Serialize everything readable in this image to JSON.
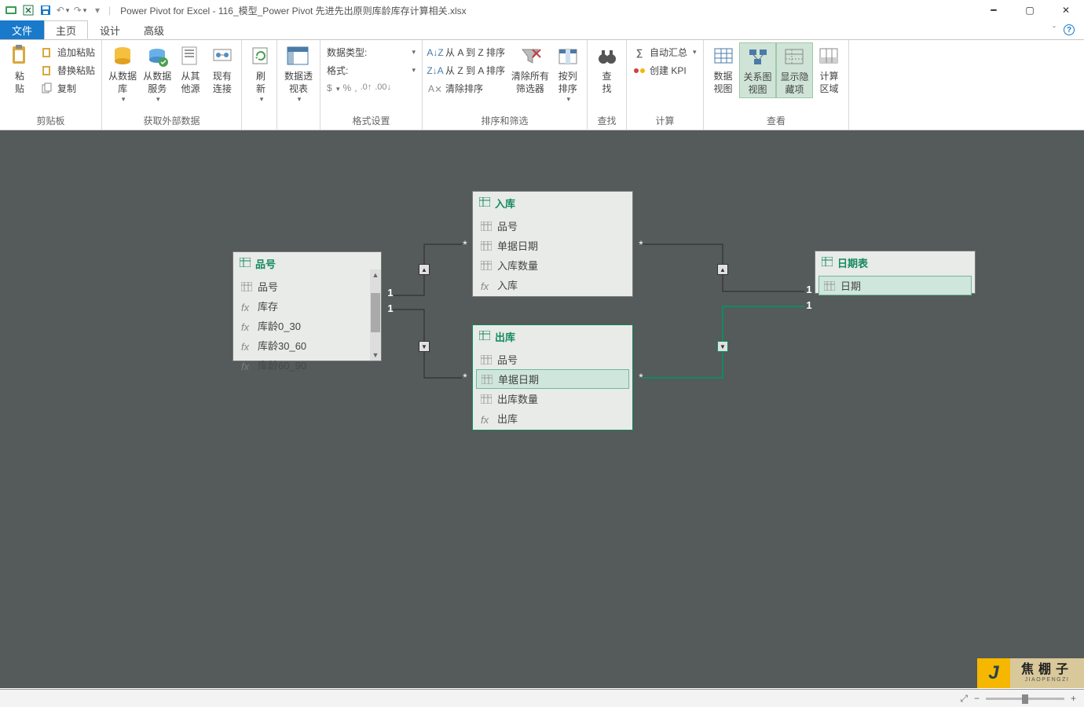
{
  "window": {
    "title": "Power Pivot for Excel - 116_模型_Power Pivot 先进先出原则库龄库存计算相关.xlsx"
  },
  "tabs": {
    "file": "文件",
    "home": "主页",
    "design": "设计",
    "advanced": "高级"
  },
  "ribbon": {
    "clipboard": {
      "label": "剪贴板",
      "paste": "粘\n贴",
      "append": "追加粘贴",
      "replace": "替换粘贴",
      "copy": "复制"
    },
    "getdata": {
      "label": "获取外部数据",
      "fromdb": "从数据\n库⁠",
      "fromsvc": "从数据\n服务⁠",
      "fromother": "从其\n他源",
      "existing": "现有\n连接"
    },
    "refresh": "刷\n新⁠",
    "pivot": "数据透\n视表⁠",
    "format": {
      "label": "格式设置",
      "datatype": "数据类型:",
      "fmt": "格式:"
    },
    "sort": {
      "label": "排序和筛选",
      "az": "从 A 到 Z 排序",
      "za": "从 Z 到 A 排序",
      "clear": "清除排序",
      "clearfilter": "清除所有\n筛选器",
      "bycol": "按列\n排序⁠"
    },
    "find": {
      "label": "查找",
      "find": "查\n找"
    },
    "calc": {
      "label": "计算",
      "autosum": "自动汇总⁠",
      "kpi": "创建 KPI"
    },
    "view": {
      "label": "查看",
      "dataview": "数据\n视图",
      "diagram": "关系图\n视图",
      "hidden": "显示隐\n藏项",
      "calcarea": "计算\n区域"
    }
  },
  "nodes": {
    "pinhao": {
      "title": "品号",
      "fields": [
        "品号",
        "库存",
        "库龄0_30",
        "库龄30_60",
        "库龄60_90"
      ]
    },
    "ruku": {
      "title": "入库",
      "fields": [
        "品号",
        "单据日期",
        "入库数量",
        "入库"
      ]
    },
    "chuku": {
      "title": "出库",
      "fields": [
        "品号",
        "单据日期",
        "出库数量",
        "出库"
      ]
    },
    "riqi": {
      "title": "日期表",
      "fields": [
        "日期"
      ]
    }
  },
  "rel": {
    "one": "1",
    "many": "*"
  },
  "brand": {
    "j": "J",
    "cn": "焦棚子",
    "en": "JIAOPENGZI"
  },
  "status": {
    "minus": "−",
    "plus": "+"
  }
}
